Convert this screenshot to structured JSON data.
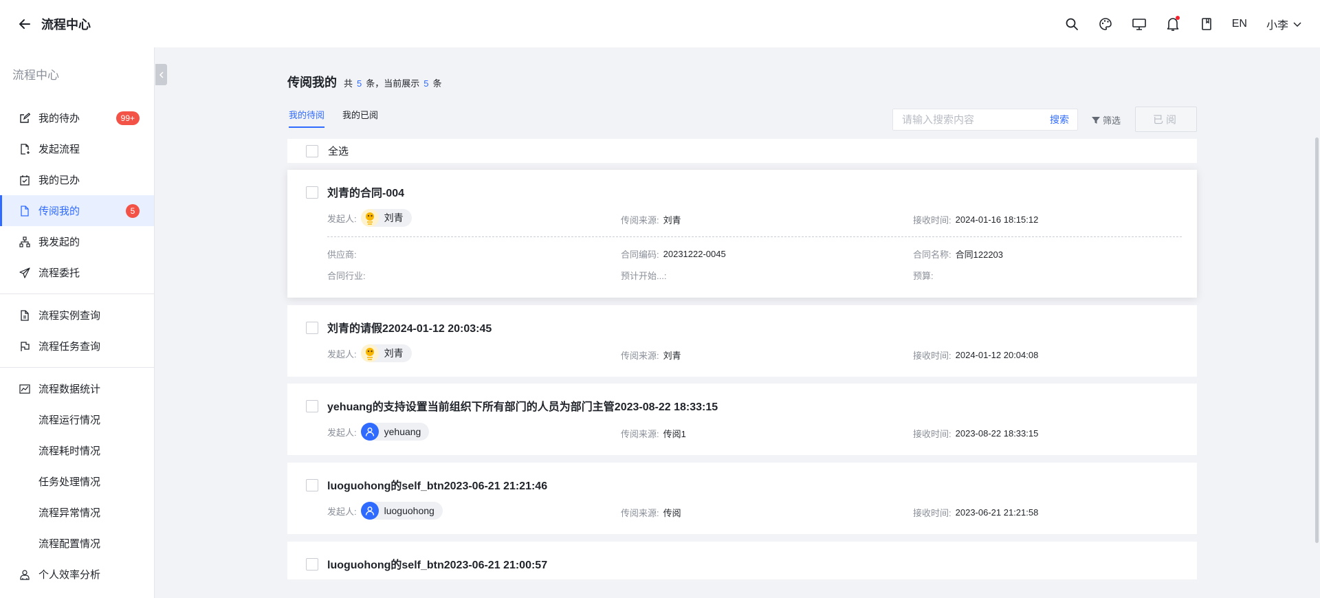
{
  "header": {
    "title": "流程中心",
    "lang": "EN",
    "user": "小李"
  },
  "sidebar": {
    "title": "流程中心",
    "items": [
      {
        "label": "我的待办",
        "icon": "edit-icon",
        "badge": "99+"
      },
      {
        "label": "发起流程",
        "icon": "file-add-icon"
      },
      {
        "label": "我的已办",
        "icon": "calendar-check-icon"
      },
      {
        "label": "传阅我的",
        "icon": "file-icon",
        "badge": "5",
        "active": true
      },
      {
        "label": "我发起的",
        "icon": "org-chart-icon"
      },
      {
        "label": "流程委托",
        "icon": "send-icon"
      },
      {
        "label": "流程实例查询",
        "icon": "file-search-icon"
      },
      {
        "label": "流程任务查询",
        "icon": "flag-icon"
      },
      {
        "label": "流程数据统计",
        "icon": "line-chart-icon"
      },
      {
        "label": "流程运行情况"
      },
      {
        "label": "流程耗时情况"
      },
      {
        "label": "任务处理情况"
      },
      {
        "label": "流程异常情况"
      },
      {
        "label": "流程配置情况"
      },
      {
        "label": "个人效率分析",
        "icon": "user-stats-icon"
      }
    ]
  },
  "main": {
    "title": "传阅我的",
    "count_prefix": "共",
    "total": "5",
    "count_mid": "条，当前展示",
    "shown": "5",
    "count_suffix": "条",
    "tabs": [
      {
        "label": "我的待阅",
        "active": true
      },
      {
        "label": "我的已阅"
      }
    ],
    "search": {
      "placeholder": "请输入搜索内容",
      "button": "搜索"
    },
    "filter_label": "筛选",
    "read_button": "已阅",
    "select_all": "全选",
    "cards": [
      {
        "title": "刘青的合同-004",
        "initiator_label": "发起人:",
        "initiator": "刘青",
        "source_label": "传阅来源:",
        "source": "刘青",
        "time_label": "接收时间:",
        "time": "2024-01-16 18:15:12",
        "extra": [
          {
            "label": "供应商:",
            "value": ""
          },
          {
            "label": "合同编码:",
            "value": "20231222-0045"
          },
          {
            "label": "合同名称:",
            "value": "合同122203"
          },
          {
            "label": "合同行业:",
            "value": ""
          },
          {
            "label": "预计开始...:",
            "value": ""
          },
          {
            "label": "预算:",
            "value": ""
          }
        ]
      },
      {
        "title": "刘青的请假22024-01-12 20:03:45",
        "initiator_label": "发起人:",
        "initiator": "刘青",
        "source_label": "传阅来源:",
        "source": "刘青",
        "time_label": "接收时间:",
        "time": "2024-01-12 20:04:08"
      },
      {
        "title": "yehuang的支持设置当前组织下所有部门的人员为部门主管2023-08-22 18:33:15",
        "initiator_label": "发起人:",
        "initiator": "yehuang",
        "source_label": "传阅来源:",
        "source": "传阅1",
        "time_label": "接收时间:",
        "time": "2023-08-22 18:33:15"
      },
      {
        "title": "luoguohong的self_btn2023-06-21 21:21:46",
        "initiator_label": "发起人:",
        "initiator": "luoguohong",
        "source_label": "传阅来源:",
        "source": "传阅",
        "time_label": "接收时间:",
        "time": "2023-06-21 21:21:58"
      },
      {
        "title": "luoguohong的self_btn2023-06-21 21:00:57"
      }
    ]
  },
  "colors": {
    "accent": "#2f6bff",
    "badge": "#f25346"
  }
}
